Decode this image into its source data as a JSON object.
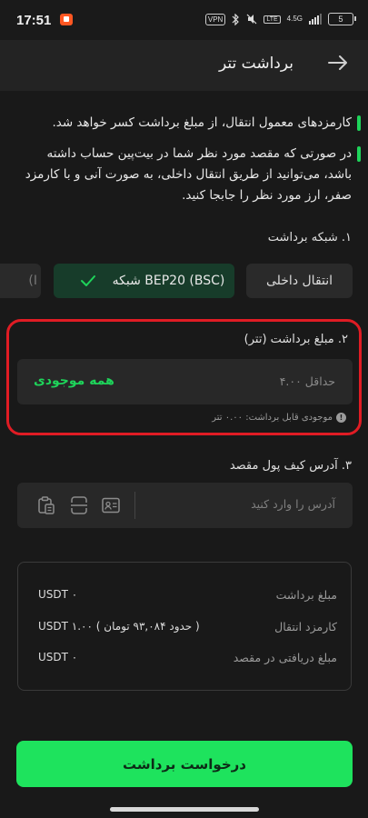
{
  "status": {
    "time": "17:51",
    "vpn": "VPN",
    "lte": "LTE",
    "net": "4.5G",
    "battery": "5"
  },
  "header": {
    "title": "برداشت تتر"
  },
  "notes": [
    "کارمزدهای معمول انتقال، از مبلغ برداشت کسر خواهد شد.",
    "در صورتی که مقصد مورد نظر شما در بیت‌پین حساب داشته باشد، می‌توانید از طریق انتقال داخلی، به صورت آنی و با کارمزد صفر، ارز مورد نظر را جابجا کنید."
  ],
  "network": {
    "section_label": "۱. شبکه برداشت",
    "internal_label": "انتقال داخلی",
    "selected_label": "شبکه BEP20 (BSC)",
    "partial_label": "(I"
  },
  "amount": {
    "section_label": "۲. مبلغ برداشت (تتر)",
    "placeholder": "حداقل ۴.۰۰",
    "all_balance_label": "همه موجودی",
    "available_text": "موجودی قابل برداشت: ۰.۰۰ تتر"
  },
  "address": {
    "section_label": "۳. آدرس کیف پول مقصد",
    "placeholder": "آدرس را وارد کنید"
  },
  "summary": {
    "rows": [
      {
        "label": "مبلغ برداشت",
        "value": "USDT ۰"
      },
      {
        "label": "کارمزد انتقال",
        "value": "USDT ۱.۰۰ ( حدود ۹۳,۰۸۴ تومان )"
      },
      {
        "label": "مبلغ دریافتی در مقصد",
        "value": "USDT ۰"
      }
    ]
  },
  "submit_label": "درخواست برداشت",
  "colors": {
    "accent": "#1ee35d",
    "highlight": "#e01c24",
    "background": "#191919"
  }
}
